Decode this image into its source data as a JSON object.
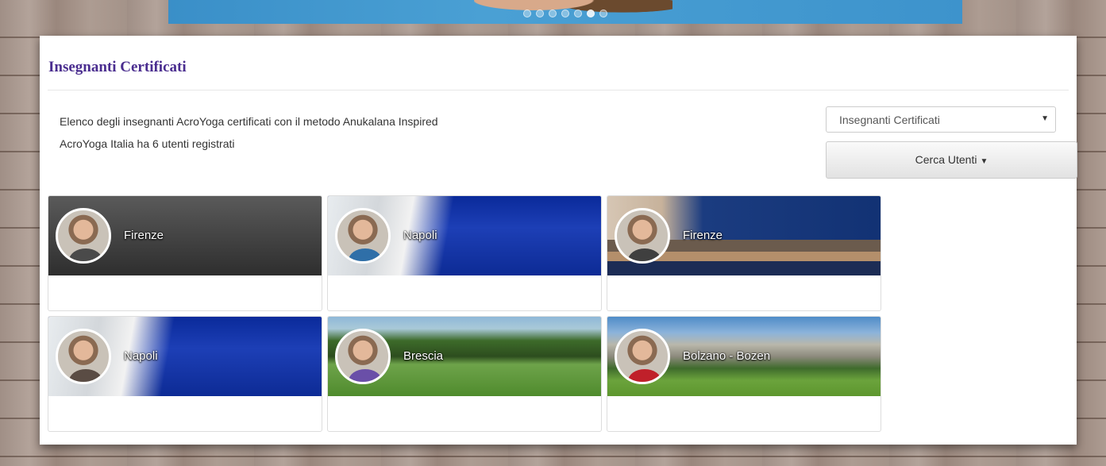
{
  "hero": {
    "slide_count": 7,
    "active_slide": 6
  },
  "panel": {
    "title": "Insegnanti Certificati",
    "description": "Elenco degli insegnanti AcroYoga certificati con il metodo Anukalana Inspired",
    "user_count_text": "AcroYoga Italia ha 6 utenti registrati"
  },
  "controls": {
    "list_select": {
      "selected": "Insegnanti Certificati"
    },
    "search_button": {
      "label": "Cerca Utenti"
    }
  },
  "users": [
    {
      "location": "Firenze",
      "cover": "gray-gradient",
      "body_color": "#4a4a4a"
    },
    {
      "location": "Napoli",
      "cover": "santorini-sea",
      "body_color": "#2f6fa8"
    },
    {
      "location": "Firenze",
      "cover": "boat-harbor",
      "body_color": "#3f3f3f"
    },
    {
      "location": "Napoli",
      "cover": "santorini-sea",
      "body_color": "#5a4c44"
    },
    {
      "location": "Brescia",
      "cover": "acroyoga-grass",
      "body_color": "#6a4fa8"
    },
    {
      "location": "Bolzano - Bozen",
      "cover": "dolomites-meadow",
      "body_color": "#c0202a"
    }
  ]
}
